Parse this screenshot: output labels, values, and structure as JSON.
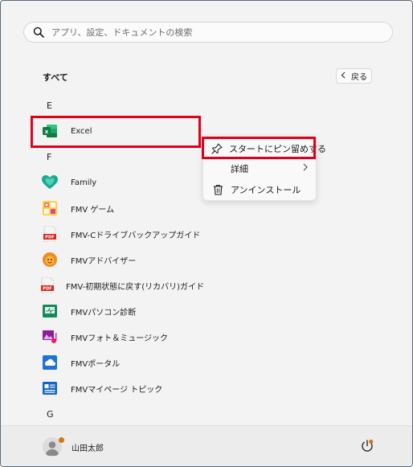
{
  "search": {
    "placeholder": "アプリ、設定、ドキュメントの検索"
  },
  "all_apps": {
    "label": "すべて",
    "back_label": "戻る"
  },
  "groups": {
    "e": "E",
    "f": "F",
    "g": "G"
  },
  "apps": [
    {
      "name": "Excel",
      "icon": "excel-icon"
    },
    {
      "name": "Family",
      "icon": "family-heart-icon"
    },
    {
      "name": "FMV ゲーム",
      "icon": "fmv-game-icon"
    },
    {
      "name": "FMV-Cドライブバックアップガイド",
      "icon": "pdf-icon"
    },
    {
      "name": "FMVアドバイザー",
      "icon": "fmv-advisor-icon"
    },
    {
      "name": "FMV-初期状態に戻す(リカバリ)ガイド",
      "icon": "pdf-icon"
    },
    {
      "name": "FMVパソコン診断",
      "icon": "pc-diagnosis-icon"
    },
    {
      "name": "FMVフォト＆ミュージック",
      "icon": "photo-music-icon"
    },
    {
      "name": "FMVポータル",
      "icon": "portal-cloud-icon"
    },
    {
      "name": "FMVマイページ トピック",
      "icon": "mypage-topic-icon"
    }
  ],
  "context_menu": {
    "pin": "スタートにピン留めする",
    "details": "詳細",
    "uninstall": "アンインストール"
  },
  "footer": {
    "user_name": "山田太郎"
  },
  "colors": {
    "highlight": "#e0001b",
    "excel_green": "#107c41",
    "accent_orange": "#d7760c"
  }
}
